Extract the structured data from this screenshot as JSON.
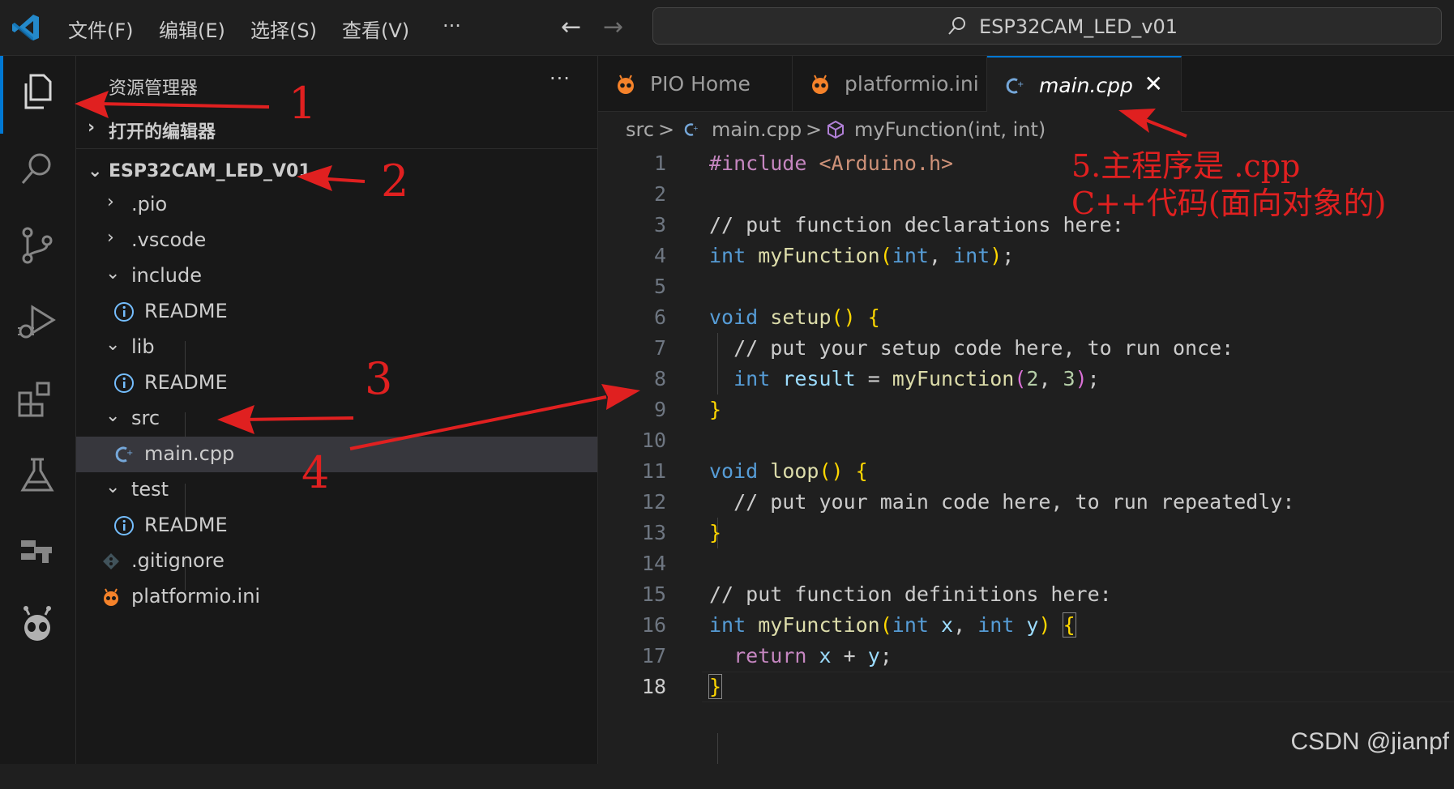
{
  "titlebar": {
    "menus": [
      "文件(F)",
      "编辑(E)",
      "选择(S)",
      "查看(V)",
      "···"
    ],
    "search_text": "ESP32CAM_LED_v01"
  },
  "activity_bar": {
    "icons": [
      "explorer-icon",
      "search-icon",
      "source-control-icon",
      "run-debug-icon",
      "extensions-icon",
      "testing-icon",
      "remote-icon",
      "platformio-icon"
    ]
  },
  "sidebar": {
    "title": "资源管理器",
    "more": "···",
    "open_editors_label": "打开的编辑器",
    "project_label": "ESP32CAM_LED_V01",
    "tree": [
      {
        "label": ".pio",
        "type": "folder",
        "expanded": false
      },
      {
        "label": ".vscode",
        "type": "folder",
        "expanded": false
      },
      {
        "label": "include",
        "type": "folder",
        "expanded": true
      },
      {
        "label": "README",
        "type": "info"
      },
      {
        "label": "lib",
        "type": "folder",
        "expanded": true
      },
      {
        "label": "README",
        "type": "info"
      },
      {
        "label": "src",
        "type": "folder",
        "expanded": true
      },
      {
        "label": "main.cpp",
        "type": "cpp",
        "selected": true
      },
      {
        "label": "test",
        "type": "folder",
        "expanded": true
      },
      {
        "label": "README",
        "type": "info"
      },
      {
        "label": ".gitignore",
        "type": "git"
      },
      {
        "label": "platformio.ini",
        "type": "pio"
      }
    ]
  },
  "editor": {
    "tabs": [
      {
        "label": "PIO Home",
        "icon": "platformio-icon"
      },
      {
        "label": "platformio.ini",
        "icon": "platformio-icon"
      },
      {
        "label": "main.cpp",
        "icon": "cpp-icon",
        "active": true,
        "close": "✕"
      }
    ],
    "breadcrumb": {
      "folder": "src",
      "file": "main.cpp",
      "symbol": "myFunction(int, int)",
      "sep": ">"
    },
    "current_line": 18,
    "lines": [
      "#include <Arduino.h>",
      "",
      "// put function declarations here:",
      "int myFunction(int, int);",
      "",
      "void setup() {",
      "  // put your setup code here, to run once:",
      "  int result = myFunction(2, 3);",
      "}",
      "",
      "void loop() {",
      "  // put your main code here, to run repeatedly:",
      "}",
      "",
      "// put function definitions here:",
      "int myFunction(int x, int y) {",
      "  return x + y;",
      "}"
    ]
  },
  "annotations": {
    "numbers": [
      "1",
      "2",
      "3",
      "4"
    ],
    "note_line1": "5.主程序是 .cpp",
    "note_line2": "C++代码(面向对象的)",
    "color": "#e02020"
  },
  "watermark": "CSDN @jianpf",
  "colors": {
    "accent": "#0078d4",
    "keyword": "#569cd6",
    "function": "#dcdcaa",
    "comment": "#6a9955",
    "string": "#ce9178",
    "variable": "#9cdcfe",
    "number": "#b5cea8",
    "bracket": "#ffd700"
  }
}
